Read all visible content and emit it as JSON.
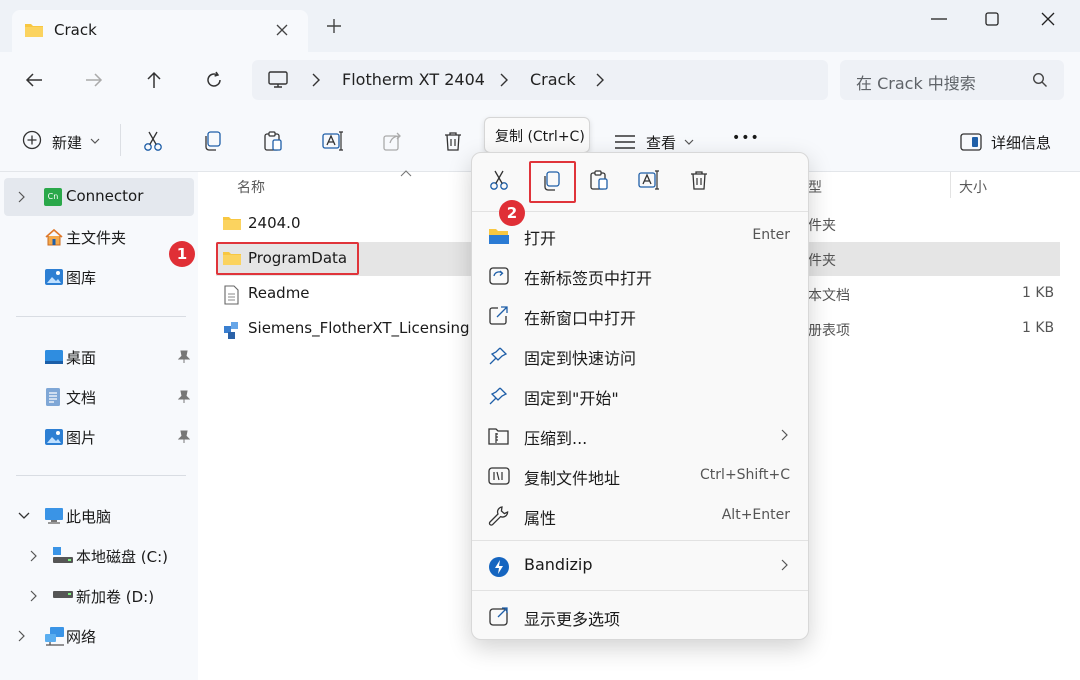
{
  "window": {
    "tab_title": "Crack",
    "new_tab": "+"
  },
  "nav": {
    "breadcrumb": [
      "Flotherm XT 2404",
      "Crack"
    ],
    "search_placeholder": "在 Crack 中搜索"
  },
  "toolbar": {
    "new_label": "新建",
    "view_label": "查看",
    "more_label": "•••",
    "details_label": "详细信息"
  },
  "tooltip": {
    "text": "复制 (Ctrl+C)"
  },
  "sidebar": {
    "items": [
      {
        "label": "Connector",
        "logo": "Cn"
      },
      {
        "label": "主文件夹"
      },
      {
        "label": "图库"
      },
      {
        "label": "桌面"
      },
      {
        "label": "文档"
      },
      {
        "label": "图片"
      },
      {
        "label": "此电脑"
      },
      {
        "label": "本地磁盘 (C:)"
      },
      {
        "label": "新加卷 (D:)"
      },
      {
        "label": "网络"
      }
    ]
  },
  "columns": {
    "name": "名称",
    "type": "型",
    "size": "大小"
  },
  "files": [
    {
      "name": "2404.0",
      "type": "件夹",
      "size": ""
    },
    {
      "name": "ProgramData",
      "type": "件夹",
      "size": ""
    },
    {
      "name": "Readme",
      "type": "本文档",
      "size": "1 KB"
    },
    {
      "name": "Siemens_FlotherXT_Licensing",
      "type": "册表项",
      "size": "1 KB"
    }
  ],
  "context_menu": {
    "items": [
      {
        "label": "打开",
        "shortcut": "Enter",
        "icon": "folder-open-icon"
      },
      {
        "label": "在新标签页中打开",
        "shortcut": "",
        "icon": "new-tab-icon"
      },
      {
        "label": "在新窗口中打开",
        "shortcut": "",
        "icon": "new-window-icon"
      },
      {
        "label": "固定到快速访问",
        "shortcut": "",
        "icon": "pin-icon"
      },
      {
        "label": "固定到\"开始\"",
        "shortcut": "",
        "icon": "pin-icon"
      },
      {
        "label": "压缩到...",
        "shortcut": "",
        "icon": "zip-icon"
      },
      {
        "label": "复制文件地址",
        "shortcut": "Ctrl+Shift+C",
        "icon": "copy-path-icon"
      },
      {
        "label": "属性",
        "shortcut": "Alt+Enter",
        "icon": "wrench-icon"
      },
      {
        "label": "Bandizip",
        "shortcut": "",
        "icon": "bandizip-icon"
      },
      {
        "label": "显示更多选项",
        "shortcut": "",
        "icon": "more-options-icon"
      }
    ]
  },
  "annotations": [
    "1",
    "2"
  ],
  "colors": {
    "accent": "#0067c0",
    "folder": "#f8c741",
    "annotation_red": "#e02f36",
    "selection": "#e5e5e5"
  }
}
